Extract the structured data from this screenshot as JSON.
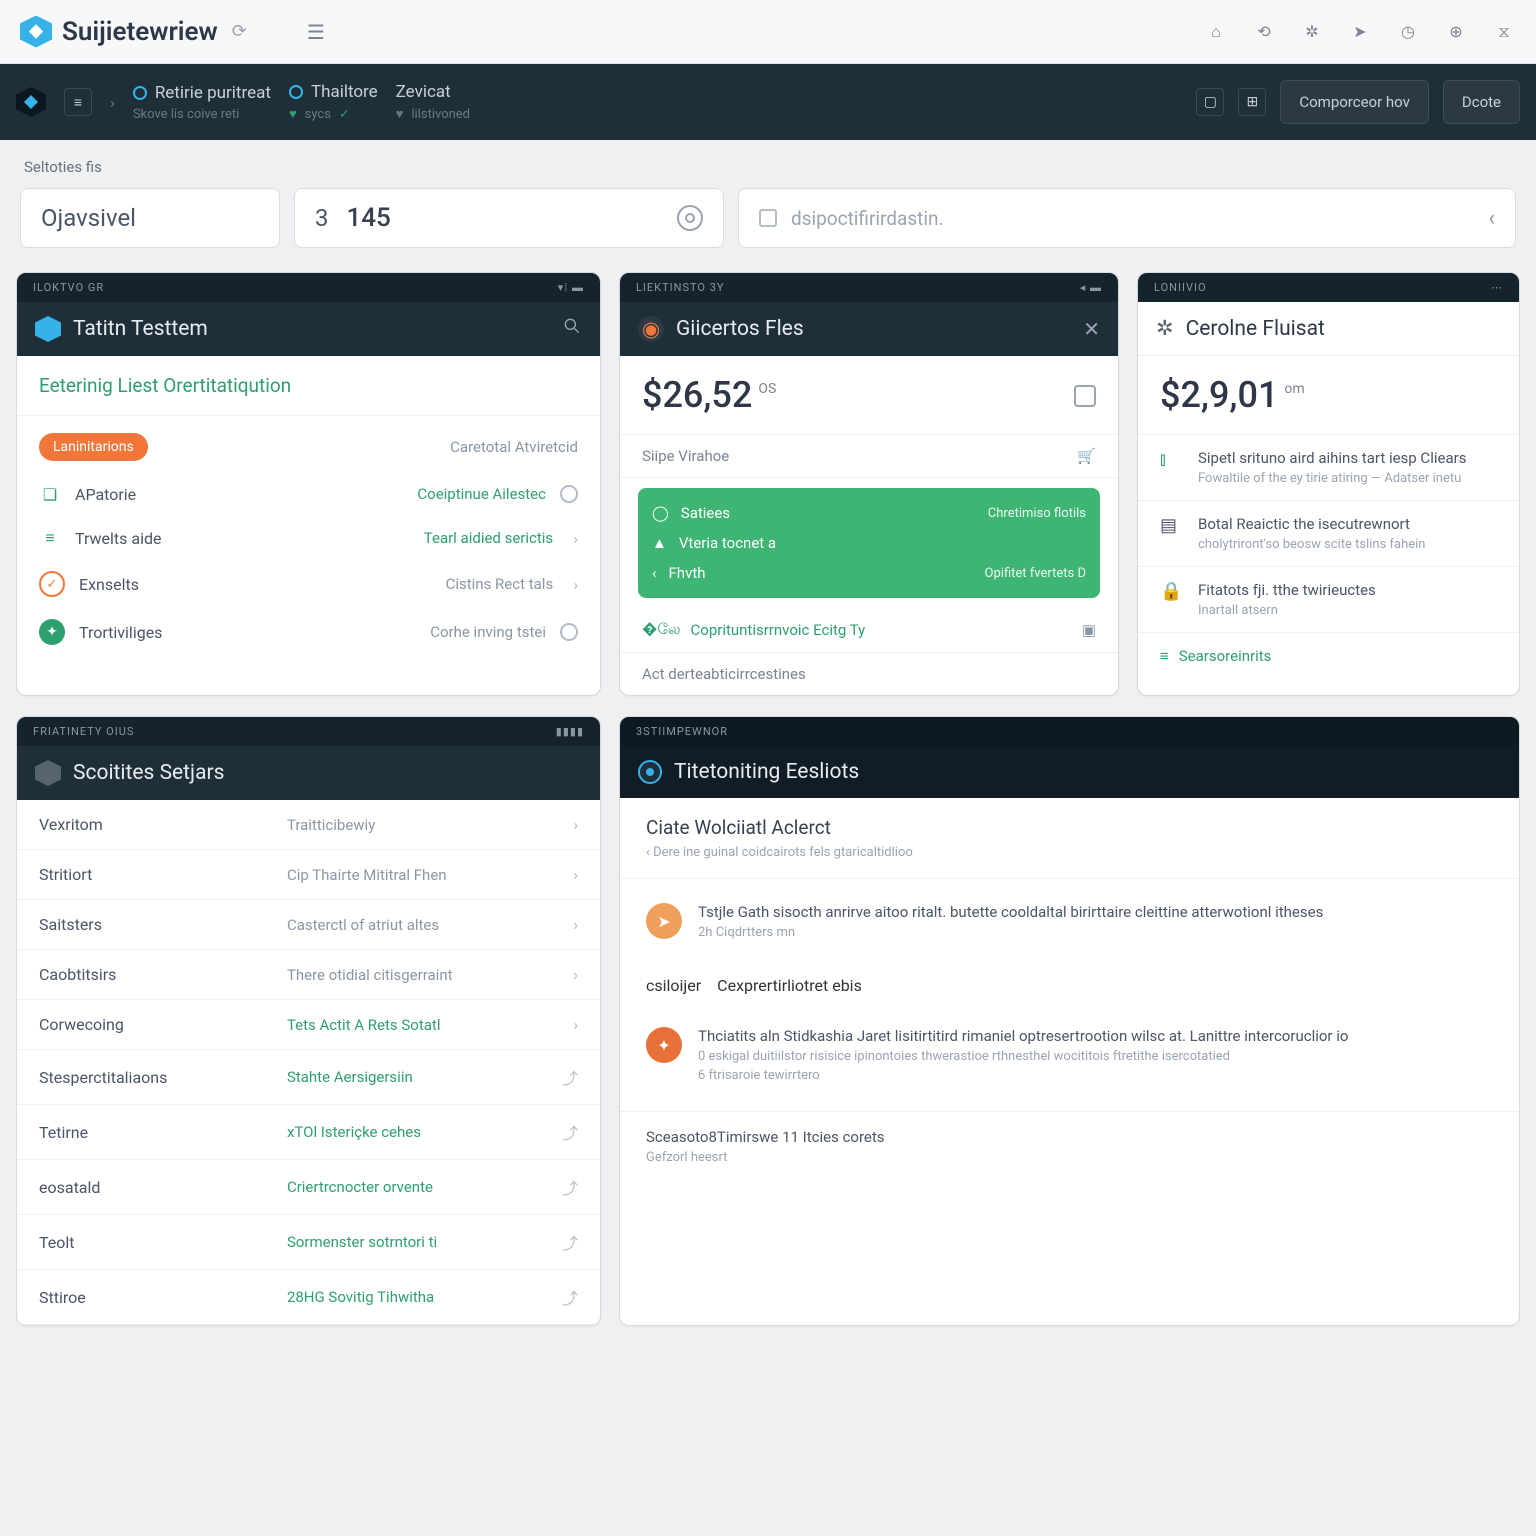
{
  "app": {
    "name": "Suijietewriew",
    "refresh_icon": "refresh",
    "menu_icon": "menu"
  },
  "topbar_icons": [
    "home",
    "sync",
    "gears",
    "send",
    "clock",
    "globe",
    "filter"
  ],
  "subbar": {
    "tabs": [
      {
        "title": "Retirie puritreat",
        "sub": "Skove lis coive reti"
      },
      {
        "title": "Thailtore",
        "sub": "sycs"
      },
      {
        "title": "Zevicat",
        "sub": "lilstivoned"
      }
    ],
    "btn1": "Comporceor hov",
    "btn2": "Dcote"
  },
  "section_label": "Seltoties fis",
  "filter": {
    "f1": "Ojavsivel",
    "f2_prefix": "3",
    "f2_value": "145",
    "f3_placeholder": "dsipoctifirirdastin.",
    "chev": "‹"
  },
  "card1": {
    "top": "ILOKTVO GR",
    "title": "Tatitn Testtem",
    "subtitle": "Eeterinig Liest Orertitatiqution",
    "items": [
      {
        "pill": "Laninitarions",
        "val": "Caretotal Atviretcid",
        "chev": false
      },
      {
        "icon": "doc",
        "lbl": "APatorie",
        "val": "Coeiptinue Ailestec",
        "circle": true
      },
      {
        "icon": "list",
        "lbl": "Trwelts aide",
        "val": "Tearl aidied serictis",
        "chev": true
      },
      {
        "check": true,
        "lbl": "Exnselts",
        "val": "Cistins Rect tals",
        "chev": true
      },
      {
        "pillgreen": true,
        "lbl": "Trortiviliges",
        "val": "Corhe inving tstei",
        "circle": true
      }
    ]
  },
  "card2": {
    "top": "LIEKTINSTO 3Y",
    "title": "Giicertos Fles",
    "price": "$26,52",
    "price_sup": "OS",
    "meta": "Siipe Virahoe",
    "green": [
      {
        "lbl": "Satiees",
        "val": "Chretimiso flotils"
      },
      {
        "lbl": "Vteria tocnet a",
        "val": ""
      },
      {
        "lbl": "Fhvth",
        "val": "Opifitet fvertets D"
      }
    ],
    "link1": "Coprituntisrrnvoic Ecitg Ty",
    "link2": "Act derteabticirrcestines"
  },
  "card3": {
    "top": "LONIIVIO",
    "title": "Cerolne Fluisat",
    "price": "$2,9,01",
    "price_sup": "om",
    "items": [
      {
        "h": "Sipetl srituno aird aihins tart iesp Cliears",
        "d": "Fowaltile of the ey tirie atiring  —  Adatser inetu"
      },
      {
        "h": "Botal Reaictic the isecutrewnort",
        "d": "cholytriront'so beosw scite tslins fahein"
      },
      {
        "h": "Fitatots fji. tthe twirieuctes",
        "d": "Inartall atsern"
      }
    ],
    "footer": "Searsoreinrits"
  },
  "card4": {
    "top": "FRIATINETY OIUS",
    "title": "Scoitites Setjars",
    "rows": [
      {
        "c1": "Vexritom",
        "c2": "Traitticibewiy",
        "g": false,
        "arr": true
      },
      {
        "c1": "Stritiort",
        "c2": "Cip Thairte Mititral Fhen",
        "g": false,
        "arr": true
      },
      {
        "c1": "Saitsters",
        "c2": "Casterctl of atriut altes",
        "g": false,
        "arr": true
      },
      {
        "c1": "Caobtitsirs",
        "c2": "There otidial citisgerraint",
        "g": false,
        "arr": true
      },
      {
        "c1": "Corwecoing",
        "c2": "Tets Actit A Rets Sotatl",
        "g": true,
        "arr": true
      },
      {
        "c1": "Stesperctitaliaons",
        "c2": "Stahte Aersigersiin",
        "g": true,
        "arr": false,
        "ico": true
      },
      {
        "c1": "Tetirne",
        "c2": "xTOl Isteriçke cehes",
        "g": true,
        "arr": false,
        "ico": true
      },
      {
        "c1": "eosatald",
        "c2": "Criertrcnocter orvente",
        "g": true,
        "arr": false,
        "ico": true
      },
      {
        "c1": "Teolt",
        "c2": "Sormenster sotrntori ti",
        "g": true,
        "arr": false,
        "ico": true
      },
      {
        "c1": "Sttiroe",
        "c2": "28HG Sovitig Tihwitha",
        "g": true,
        "arr": false,
        "ico": true
      }
    ]
  },
  "card5": {
    "top": "3STIIMPEWNOR",
    "title": "Titetoniting Eesliots",
    "sub_h": "Ciate Wolciiatl Aclerct",
    "sub_d": "‹ Dere ine guinal coidcairots fels gtaricaltidlioo",
    "feed": [
      {
        "t": "Tstjle Gath sisocth anrirve aitoo ritalt. butette cooldaltal birirttaire cleittine atterwotionl itheses",
        "m": "2h Ciqdrtters mn"
      },
      {
        "label_l": "csiloijer",
        "label_r": "Cexprertirliotret ebis"
      },
      {
        "t": "Thciatits aln Stidkashia Jaret lisitirtitird rimaniel optresertrootion wilsc at.     Lanittre intercoruclior io",
        "m": "0 eskigal duitiilstor risisice ipinontoies thwerastioe rthnesthel  wocititois ftretithe isercotatied"
      },
      {
        "m2": "6 ftrisaroie tewirrtero"
      }
    ],
    "foot_t": "Sceasoto8Timirswe 11 Itcies corets",
    "foot_m": "Gefzorl heesrt"
  }
}
